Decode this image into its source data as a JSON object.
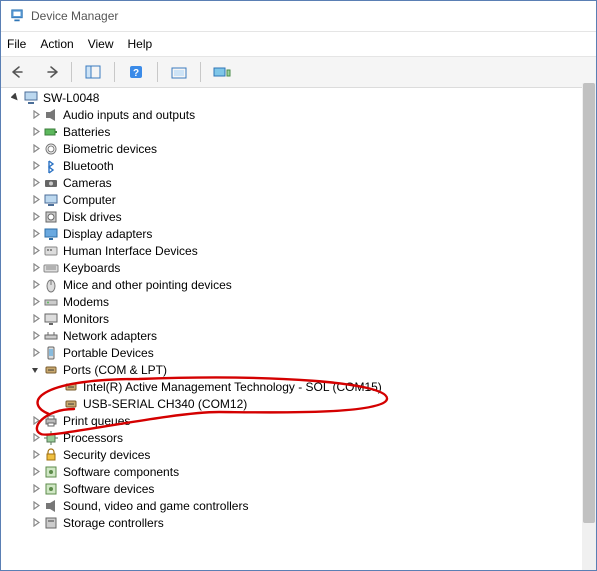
{
  "window": {
    "title": "Device Manager"
  },
  "menu": {
    "file": "File",
    "action": "Action",
    "view": "View",
    "help": "Help"
  },
  "root": {
    "name": "SW-L0048"
  },
  "categories": [
    {
      "label": "Audio inputs and outputs",
      "icon": "speaker"
    },
    {
      "label": "Batteries",
      "icon": "battery"
    },
    {
      "label": "Biometric devices",
      "icon": "fingerprint"
    },
    {
      "label": "Bluetooth",
      "icon": "bluetooth"
    },
    {
      "label": "Cameras",
      "icon": "camera"
    },
    {
      "label": "Computer",
      "icon": "computer"
    },
    {
      "label": "Disk drives",
      "icon": "disk"
    },
    {
      "label": "Display adapters",
      "icon": "display"
    },
    {
      "label": "Human Interface Devices",
      "icon": "hid"
    },
    {
      "label": "Keyboards",
      "icon": "keyboard"
    },
    {
      "label": "Mice and other pointing devices",
      "icon": "mouse"
    },
    {
      "label": "Modems",
      "icon": "modem"
    },
    {
      "label": "Monitors",
      "icon": "monitor"
    },
    {
      "label": "Network adapters",
      "icon": "network"
    },
    {
      "label": "Portable Devices",
      "icon": "portable"
    },
    {
      "label": "Ports (COM & LPT)",
      "icon": "port",
      "expanded": true,
      "children": [
        {
          "label": "Intel(R) Active Management Technology - SOL (COM15)",
          "icon": "port"
        },
        {
          "label": "USB-SERIAL CH340 (COM12)",
          "icon": "port"
        }
      ]
    },
    {
      "label": "Print queues",
      "icon": "printer"
    },
    {
      "label": "Processors",
      "icon": "cpu"
    },
    {
      "label": "Security devices",
      "icon": "security"
    },
    {
      "label": "Software components",
      "icon": "software"
    },
    {
      "label": "Software devices",
      "icon": "software"
    },
    {
      "label": "Sound, video and game controllers",
      "icon": "speaker"
    },
    {
      "label": "Storage controllers",
      "icon": "storage"
    }
  ]
}
